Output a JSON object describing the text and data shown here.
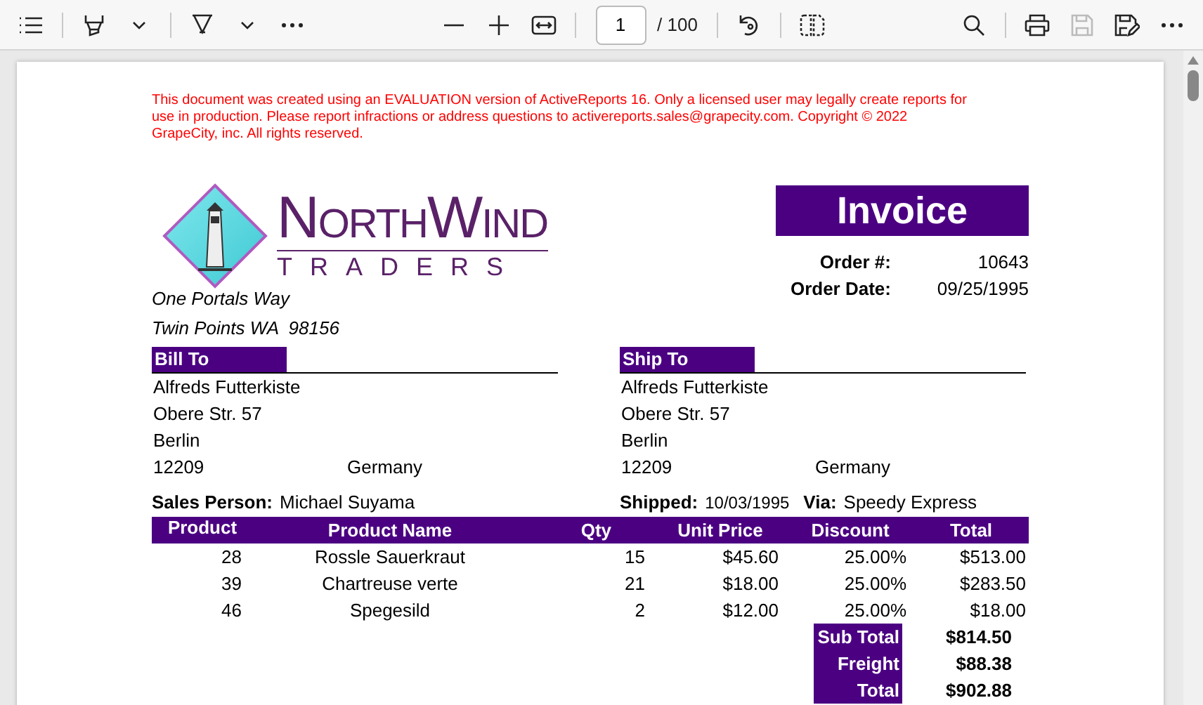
{
  "toolbar": {
    "page_input": {
      "value": "1"
    },
    "page_count": "/ 100",
    "save_button": {
      "disabled": true
    }
  },
  "document": {
    "evaluation_notice": "This document was created using an EVALUATION version of ActiveReports 16. Only a licensed user may legally create reports for use in production. Please report infractions or address questions to activereports.sales@grapecity.com. Copyright © 2022 GrapeCity, inc. All rights reserved.",
    "logo": {
      "name": "NorthWind",
      "tagline": "TRADERS"
    },
    "company_address": [
      "One Portals Way",
      "Twin Points WA  98156"
    ],
    "title": "Invoice",
    "order_fields": [
      {
        "label": "Order #:",
        "value": "10643"
      },
      {
        "label": "Order Date:",
        "value": "09/25/1995"
      }
    ],
    "addresses": [
      {
        "heading": "Bill To",
        "name": "Alfreds Futterkiste",
        "street": "Obere Str. 57",
        "city": "Berlin",
        "postal_code": "12209",
        "country": "Germany"
      },
      {
        "heading": "Ship To",
        "name": "Alfreds Futterkiste",
        "street": "Obere Str. 57",
        "city": "Berlin",
        "postal_code": "12209",
        "country": "Germany"
      }
    ],
    "sales_person": {
      "label": "Sales Person:",
      "value": "Michael Suyama"
    },
    "shipped": {
      "label": "Shipped:",
      "value": "10/03/1995"
    },
    "via": {
      "label": "Via:",
      "value": "Speedy Express"
    },
    "table": {
      "columns": [
        "Product",
        "Product Name",
        "Qty",
        "Unit Price",
        "Discount",
        "Total"
      ],
      "rows": [
        [
          "28",
          "Rossle Sauerkraut",
          "15",
          "$45.60",
          "25.00%",
          "$513.00"
        ],
        [
          "39",
          "Chartreuse verte",
          "21",
          "$18.00",
          "25.00%",
          "$283.50"
        ],
        [
          "46",
          "Spegesild",
          "2",
          "$12.00",
          "25.00%",
          "$18.00"
        ]
      ]
    },
    "totals": [
      {
        "label": "Sub Total",
        "value": "$814.50"
      },
      {
        "label": "Freight",
        "value": "$88.38"
      },
      {
        "label": "Total",
        "value": "$902.88"
      }
    ]
  }
}
